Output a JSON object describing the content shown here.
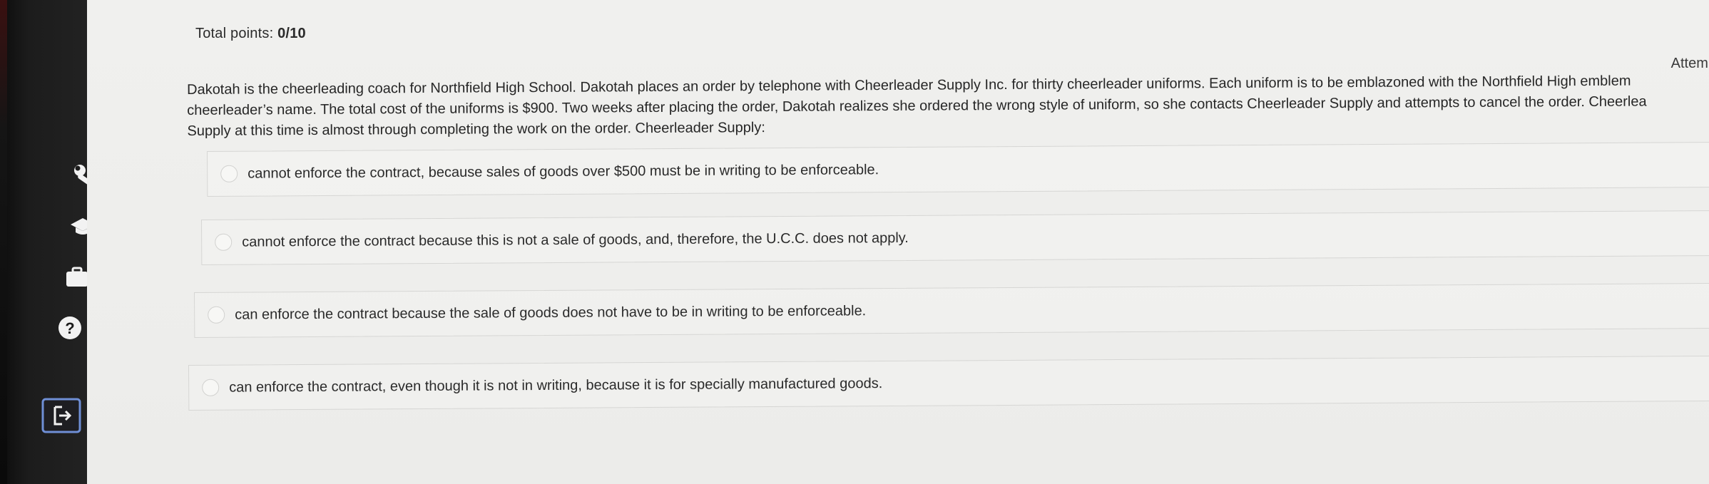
{
  "quiz": {
    "total_points_label": "Total points:",
    "total_points_value": "0/10",
    "attempt_label": "Attemp",
    "question_lines": [
      "Dakotah is the cheerleading coach for Northfield High School. Dakotah places an order by telephone with Cheerleader Supply Inc. for thirty cheerleader uniforms. Each uniform is to be emblazoned with the Northfield High emblem",
      "cheerleader’s name. The total cost of the uniforms is $900. Two weeks after placing the order, Dakotah realizes she ordered the wrong style of uniform, so she contacts Cheerleader Supply and attempts to cancel the order. Cheerlea",
      "Supply at this time is almost through completing the work on the order. Cheerleader Supply:"
    ],
    "options": [
      {
        "label": "cannot enforce the contract, because sales of goods over $500 must be in writing to be enforceable."
      },
      {
        "label": "cannot enforce the contract because this is not a sale of goods, and, therefore, the U.C.C. does not apply."
      },
      {
        "label": "can enforce the contract because the sale of goods does not have to be in writing to be enforceable."
      },
      {
        "label": "can enforce the contract, even though it is not in writing, because it is for specially manufactured goods."
      }
    ]
  },
  "sidebar": {
    "icons": [
      "notebook-icon",
      "id-card-icon",
      "wrench-icon",
      "graduation-cap-icon",
      "briefcase-icon",
      "help-icon",
      "logout-icon"
    ]
  },
  "colors": {
    "sidebar_bg": "#1c1c1c",
    "content_bg": "#eeeeec",
    "text": "#2a2a2a",
    "option_border": "#d6d6d4",
    "logout_border": "#6f8fd6"
  }
}
